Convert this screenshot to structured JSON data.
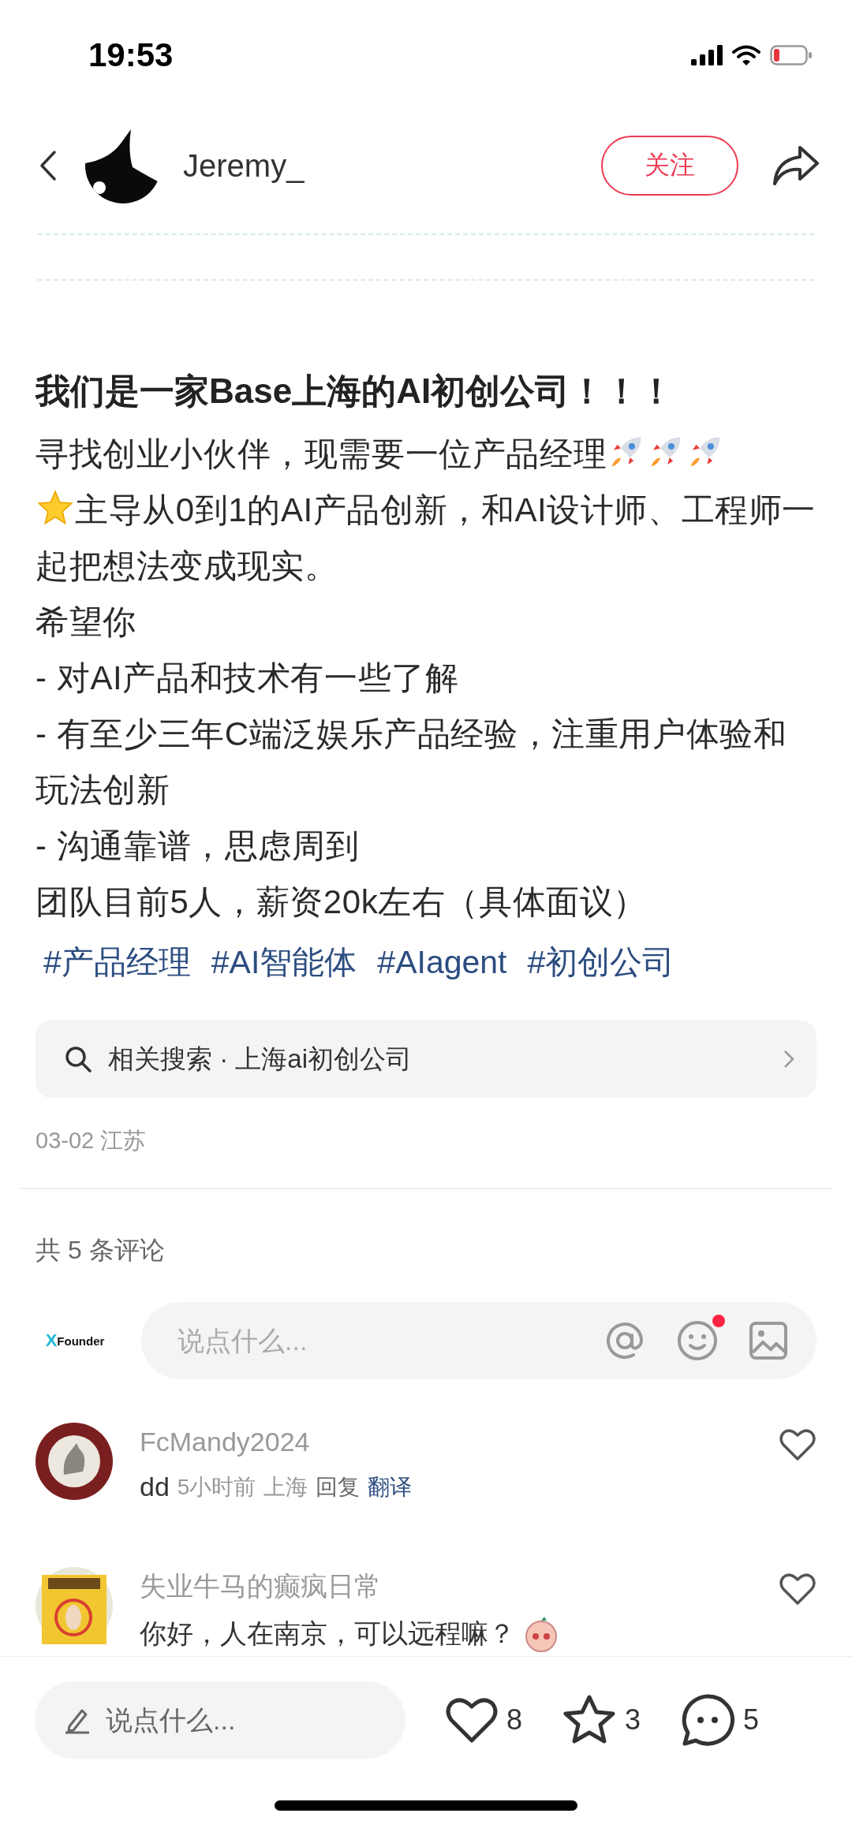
{
  "status_bar": {
    "time": "19:53"
  },
  "header": {
    "username": "Jeremy_",
    "follow_label": "关注"
  },
  "post": {
    "title": "我们是一家Base上海的AI初创公司！！！",
    "body": [
      {
        "segments": [
          {
            "kind": "text",
            "text": "寻找创业小伙伴，现需要一位产品经理"
          },
          {
            "kind": "rocket"
          },
          {
            "kind": "rocket"
          },
          {
            "kind": "rocket"
          }
        ]
      },
      {
        "segments": [
          {
            "kind": "star"
          },
          {
            "kind": "text",
            "text": "主导从0到1的AI产品创新，和AI设计师、工程师一起把想法变成现实。"
          }
        ]
      },
      {
        "segments": [
          {
            "kind": "text",
            "text": "希望你"
          }
        ]
      },
      {
        "segments": [
          {
            "kind": "text",
            "text": "- 对AI产品和技术有一些了解"
          }
        ]
      },
      {
        "segments": [
          {
            "kind": "text",
            "text": "- 有至少三年C端泛娱乐产品经验，注重用户体验和玩法创新"
          }
        ]
      },
      {
        "segments": [
          {
            "kind": "text",
            "text": "- 沟通靠谱，思虑周到"
          }
        ]
      },
      {
        "segments": [
          {
            "kind": "text",
            "text": "团队目前5人，薪资20k左右（具体面议）"
          }
        ]
      }
    ],
    "tags": [
      "#产品经理",
      "#AI智能体",
      "#AIagent",
      "#初创公司"
    ],
    "related_search": "相关搜索 · 上海ai初创公司",
    "meta": "03-02 江苏"
  },
  "comments_header": "共 5 条评论",
  "comment_input": {
    "logo_mark": "X",
    "logo_name": "Founder",
    "placeholder": "说点什么...",
    "emoji_badge": true
  },
  "comments": [
    {
      "author": "FcMandy2024",
      "text": "dd",
      "time": "5小时前",
      "location": "上海",
      "reply": "回复",
      "translate": "翻译"
    },
    {
      "author": "失业牛马的癫疯日常",
      "text": "你好，人在南京，可以远程嘛？",
      "sticker": true
    }
  ],
  "bottom_bar": {
    "placeholder": "说点什么...",
    "likes": "8",
    "stars": "3",
    "comments": "5"
  }
}
